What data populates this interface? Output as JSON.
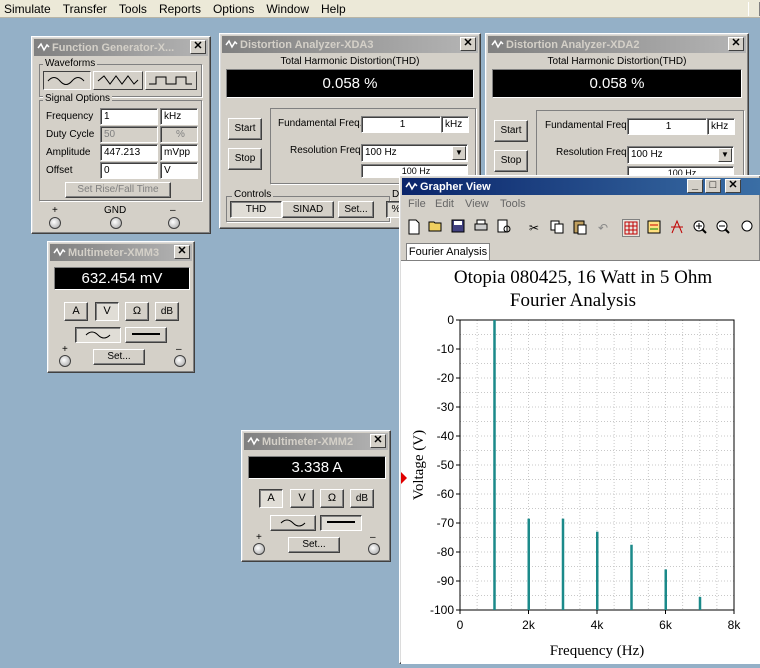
{
  "menu": [
    "Simulate",
    "Transfer",
    "Tools",
    "Reports",
    "Options",
    "Window",
    "Help"
  ],
  "function_generator": {
    "title": "Function Generator-X...",
    "waveforms_label": "Waveforms",
    "signal_options_label": "Signal Options",
    "frequency_label": "Frequency",
    "frequency_value": "1",
    "frequency_unit": "kHz",
    "duty_cycle_label": "Duty Cycle",
    "duty_cycle_value": "50",
    "duty_cycle_unit": "%",
    "amplitude_label": "Amplitude",
    "amplitude_value": "447.213",
    "amplitude_unit": "mVpp",
    "offset_label": "Offset",
    "offset_value": "0",
    "offset_unit": "V",
    "rise_fall_button": "Set Rise/Fall Time",
    "terminals": [
      "+",
      "GND",
      "–"
    ]
  },
  "distortion_xda3": {
    "title": "Distortion Analyzer-XDA3",
    "thd_label": "Total Harmonic Distortion(THD)",
    "thd_value": "0.058 %",
    "start": "Start",
    "stop": "Stop",
    "fund_label": "Fundamental Freq.",
    "fund_value": "1",
    "fund_unit": "kHz",
    "res_label": "Resolution Freq.",
    "res_value": "100 Hz",
    "res_value2": "100 Hz",
    "controls_label": "Controls",
    "display_label": "Di",
    "thd_btn": "THD",
    "sinad_btn": "SINAD",
    "set_btn": "Set...",
    "pct_btn": "%"
  },
  "distortion_xda2": {
    "title": "Distortion Analyzer-XDA2",
    "thd_label": "Total Harmonic Distortion(THD)",
    "thd_value": "0.058 %",
    "start": "Start",
    "stop": "Stop",
    "fund_label": "Fundamental Freq.",
    "fund_value": "1",
    "fund_unit": "kHz",
    "res_label": "Resolution Freq.",
    "res_value": "100 Hz",
    "res_value2": "100 Hz"
  },
  "multimeter_xmm3": {
    "title": "Multimeter-XMM3",
    "reading": "632.454 mV",
    "buttons": [
      "A",
      "V",
      "Ω",
      "dB"
    ],
    "set": "Set...",
    "plus": "+",
    "minus": "–"
  },
  "multimeter_xmm2": {
    "title": "Multimeter-XMM2",
    "reading": "3.338 A",
    "buttons": [
      "A",
      "V",
      "Ω",
      "dB"
    ],
    "set": "Set...",
    "plus": "+",
    "minus": "–"
  },
  "grapher": {
    "title": "Grapher View",
    "menu": [
      "File",
      "Edit",
      "View",
      "Tools"
    ],
    "tab": "Fourier Analysis"
  },
  "chart_data": {
    "type": "bar",
    "title": "Otopia 080425, 16 Watt in 5 Ohm",
    "subtitle": "Fourier Analysis",
    "xlabel": "Frequency (Hz)",
    "ylabel": "Voltage (V)",
    "xlim": [
      0,
      8000
    ],
    "ylim": [
      -100,
      0
    ],
    "x_ticks": [
      0,
      2000,
      4000,
      6000,
      8000
    ],
    "x_tick_labels": [
      "0",
      "2k",
      "4k",
      "6k",
      "8k"
    ],
    "y_ticks": [
      0,
      -10,
      -20,
      -30,
      -40,
      -50,
      -60,
      -70,
      -80,
      -90,
      -100
    ],
    "grid": true,
    "bar_color": "#1b8a8a",
    "x": [
      1000,
      2000,
      3000,
      4000,
      5000,
      6000,
      7000
    ],
    "values": [
      0,
      -68.5,
      -68.5,
      -73,
      -77.5,
      -86,
      -95.5
    ]
  }
}
